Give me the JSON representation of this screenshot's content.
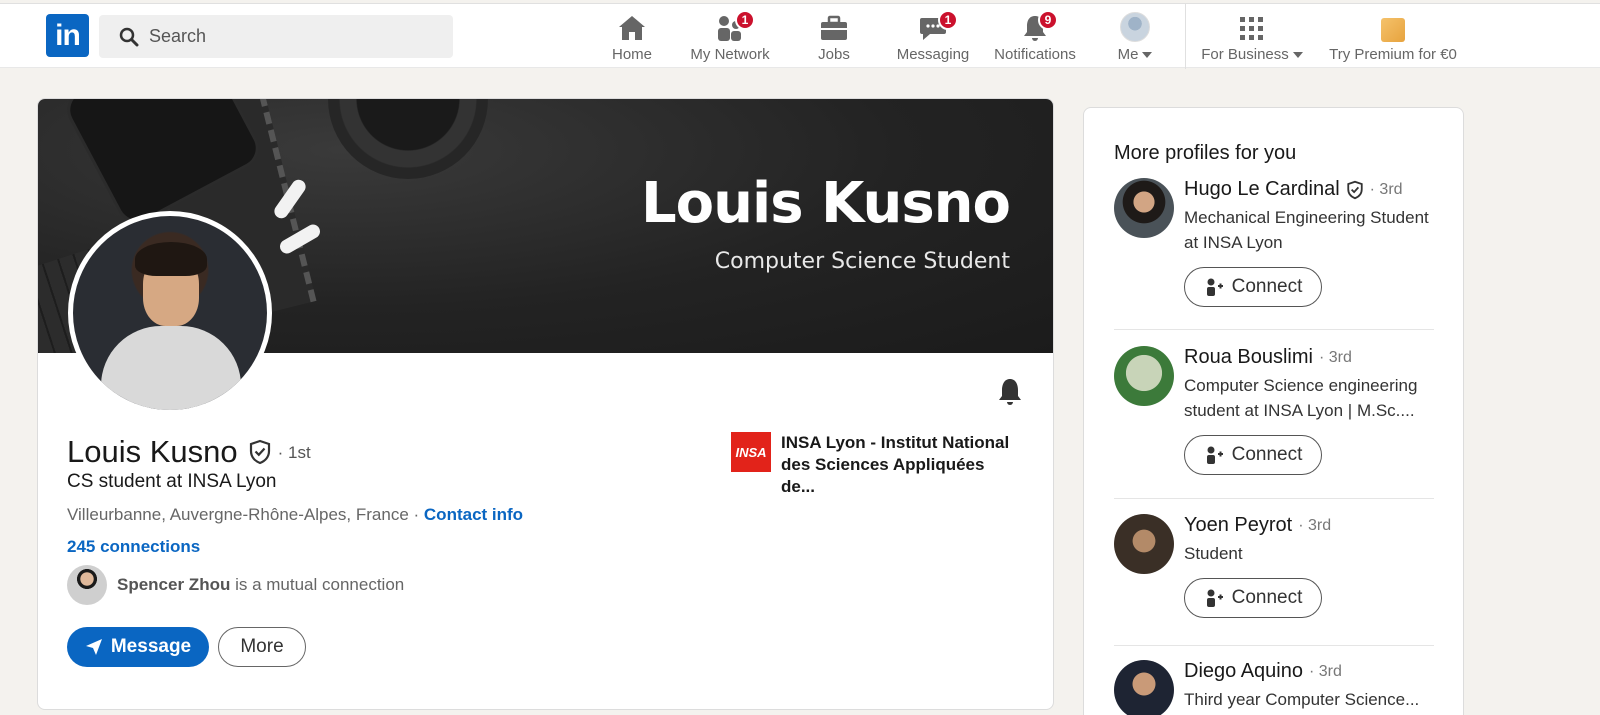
{
  "nav": {
    "search_placeholder": "Search",
    "items": [
      {
        "label": "Home"
      },
      {
        "label": "My Network",
        "badge": "1"
      },
      {
        "label": "Jobs"
      },
      {
        "label": "Messaging",
        "badge": "1"
      },
      {
        "label": "Notifications",
        "badge": "9"
      },
      {
        "label": "Me"
      }
    ],
    "business": "For Business",
    "premium": "Try Premium for €0"
  },
  "profile": {
    "banner_name": "Louis Kusno",
    "banner_subtitle": "Computer Science Student",
    "name": "Louis Kusno",
    "degree": "· 1st",
    "headline": "CS student at INSA Lyon",
    "location": "Villeurbanne, Auvergne-Rhône-Alpes, France",
    "location_sep": " · ",
    "contact_info": "Contact info",
    "connections": "245 connections",
    "mutual_name": "Spencer Zhou",
    "mutual_text": " is a mutual connection",
    "message_btn": "Message",
    "more_btn": "More",
    "school_logo": "INSA",
    "school_name": "INSA Lyon - Institut National des Sciences Appliquées de..."
  },
  "sidebar": {
    "title": "More profiles for you",
    "connect_label": "Connect",
    "profiles": [
      {
        "name": "Hugo Le Cardinal",
        "degree": "· 3rd",
        "desc": "Mechanical Engineering Student at INSA Lyon"
      },
      {
        "name": "Roua Bouslimi",
        "degree": "· 3rd",
        "desc_line1": "Computer Science engineering",
        "desc_line2": "student at INSA Lyon | M.Sc...."
      },
      {
        "name": "Yoen Peyrot",
        "degree": "· 3rd",
        "desc": "Student"
      },
      {
        "name": "Diego Aquino",
        "degree": "· 3rd",
        "desc": "Third year Computer Science..."
      }
    ]
  },
  "colors": {
    "brand": "#0a66c2",
    "badge": "#cb112d",
    "page_bg": "#f4f2ee"
  }
}
